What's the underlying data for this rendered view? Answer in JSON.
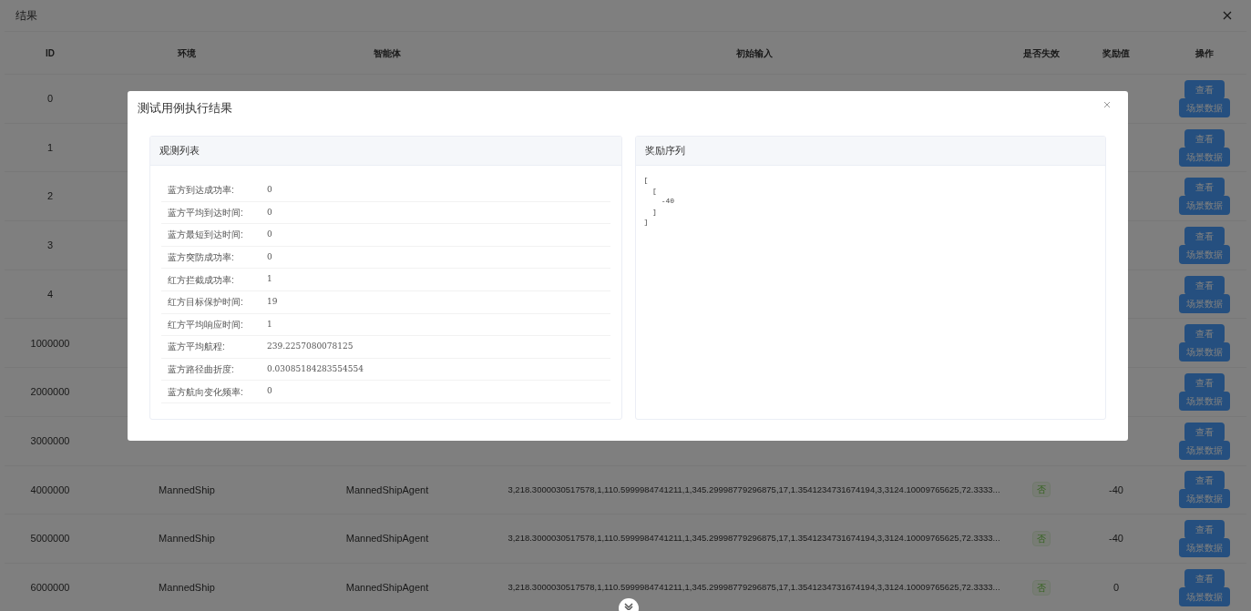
{
  "dialog": {
    "title": "结果"
  },
  "table": {
    "columns": [
      "ID",
      "环境",
      "智能体",
      "初始输入",
      "是否失效",
      "奖励值",
      "操作"
    ],
    "rows": [
      {
        "id": "0",
        "actions": [
          "查看",
          "场景数据"
        ]
      },
      {
        "id": "1",
        "actions": [
          "查看",
          "场景数据"
        ]
      },
      {
        "id": "2",
        "actions": [
          "查看",
          "场景数据"
        ]
      },
      {
        "id": "3",
        "actions": [
          "查看",
          "场景数据"
        ]
      },
      {
        "id": "4",
        "actions": [
          "查看",
          "场景数据"
        ]
      },
      {
        "id": "1000000",
        "actions": [
          "查看",
          "场景数据"
        ]
      },
      {
        "id": "2000000",
        "actions": [
          "查看",
          "场景数据"
        ]
      },
      {
        "id": "3000000",
        "actions": [
          "查看",
          "场景数据"
        ]
      },
      {
        "id": "4000000",
        "environment": "MannedShip",
        "agent": "MannedShipAgent",
        "initial_input": "3,218.3000030517578,1,110.5999984741211,1,345.29998779296875,17,1.3541234731674194,3,3124.10009765625,72.3333...",
        "failed": "否",
        "reward": "-40",
        "actions": [
          "查看",
          "场景数据"
        ]
      },
      {
        "id": "5000000",
        "environment": "MannedShip",
        "agent": "MannedShipAgent",
        "initial_input": "3,218.3000030517578,1,110.5999984741211,1,345.29998779296875,17,1.3541234731674194,3,3124.10009765625,72.3333...",
        "failed": "否",
        "reward": "-40",
        "actions": [
          "查看",
          "场景数据"
        ]
      },
      {
        "id": "6000000",
        "environment": "MannedShip",
        "agent": "MannedShipAgent",
        "initial_input": "3,218.3000030517578,1,110.5999984741211,1,345.29998779296875,17,1.3541234731674194,3,3124.10009765625,72.3333...",
        "failed": "否",
        "reward": "0",
        "actions": [
          "查看",
          "场景数据"
        ]
      }
    ]
  },
  "modal": {
    "title": "测试用例执行结果",
    "observations": {
      "title": "观测列表",
      "items": [
        {
          "label": "蓝方到达成功率:",
          "value": "0"
        },
        {
          "label": "蓝方平均到达时间:",
          "value": "0"
        },
        {
          "label": "蓝方最短到达时间:",
          "value": "0"
        },
        {
          "label": "蓝方突防成功率:",
          "value": "0"
        },
        {
          "label": "红方拦截成功率:",
          "value": "1"
        },
        {
          "label": "红方目标保护时间:",
          "value": "19"
        },
        {
          "label": "红方平均响应时间:",
          "value": "1"
        },
        {
          "label": "蓝方平均航程:",
          "value": "239.2257080078125"
        },
        {
          "label": "蓝方路径曲折度:",
          "value": "0.03085184283554554"
        },
        {
          "label": "蓝方航向变化频率:",
          "value": "0"
        }
      ]
    },
    "rewards": {
      "title": "奖励序列",
      "lines": [
        "[",
        "  [",
        "    -40",
        "  ]",
        "]"
      ]
    }
  }
}
